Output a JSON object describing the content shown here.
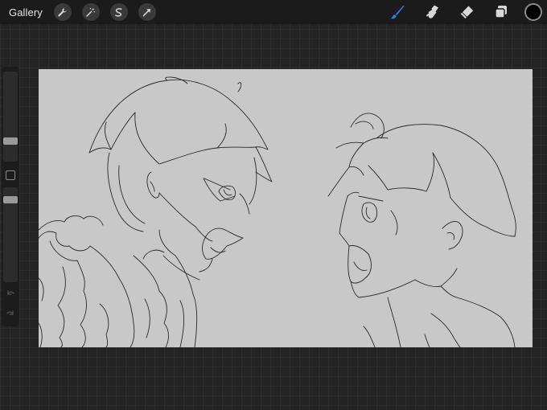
{
  "topbar": {
    "gallery_label": "Gallery",
    "left_tools": [
      "wrench-icon",
      "magic-wand-icon",
      "selection-icon",
      "transform-arrow-icon"
    ],
    "right_tools": [
      "brush-icon",
      "smudge-icon",
      "eraser-icon",
      "layers-icon"
    ],
    "active_tool": "brush-icon",
    "accent_color": "#2f7cf6",
    "current_color": "#000000"
  },
  "sidebar": {
    "brush_size_level": 0.55,
    "opacity_level": 0.6,
    "controls": [
      "brush-size-slider",
      "modify-button",
      "opacity-slider",
      "undo-icon",
      "redo-icon"
    ]
  },
  "canvas": {
    "background": "#c8c8c8",
    "content": "line-art-sketch"
  }
}
